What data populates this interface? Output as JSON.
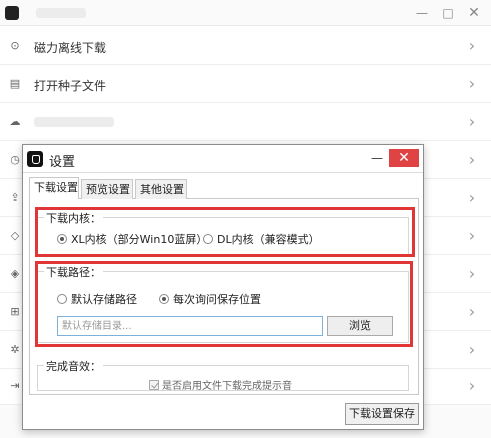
{
  "background_app": {
    "window_controls": {
      "minimize": "—",
      "maximize": "□",
      "close": "✕"
    },
    "rows": [
      {
        "label": "磁力离线下载",
        "icon": "magnet-icon"
      },
      {
        "label": "打开种子文件",
        "icon": "file-icon"
      },
      {
        "label": "",
        "icon": "cloud-icon"
      },
      {
        "label": "",
        "icon": "clock-icon"
      },
      {
        "label": "",
        "icon": "upload-icon"
      },
      {
        "label": "",
        "icon": "gem-icon"
      },
      {
        "label": "",
        "icon": "shield-icon"
      },
      {
        "label": "",
        "icon": "sitemap-icon"
      },
      {
        "label": "",
        "icon": "gear-icon"
      },
      {
        "label": "",
        "icon": "exit-icon"
      }
    ],
    "chevron": "›"
  },
  "dialog": {
    "title": "设置",
    "controls": {
      "minimize": "—",
      "close": "✕"
    },
    "tabs": [
      "下载设置",
      "预览设置",
      "其他设置"
    ],
    "kernel_group": {
      "legend": "下载内核：",
      "options": [
        {
          "label": "XL内核（部分Win10蓝屏）",
          "selected": true
        },
        {
          "label": "DL内核（兼容模式）",
          "selected": false
        }
      ]
    },
    "path_group": {
      "legend": "下载路径：",
      "options": [
        {
          "label": "默认存储路径",
          "selected": false
        },
        {
          "label": "每次询问保存位置",
          "selected": true
        }
      ],
      "input_placeholder": "默认存储目录...",
      "browse_label": "浏览"
    },
    "sound_group": {
      "legend": "完成音效：",
      "checkbox_label": "是否启用文件下载完成提示音",
      "checkbox_checked": true
    },
    "save_label": "下载设置保存"
  },
  "colors": {
    "highlight": "#e03636",
    "close_button": "#e04343"
  }
}
